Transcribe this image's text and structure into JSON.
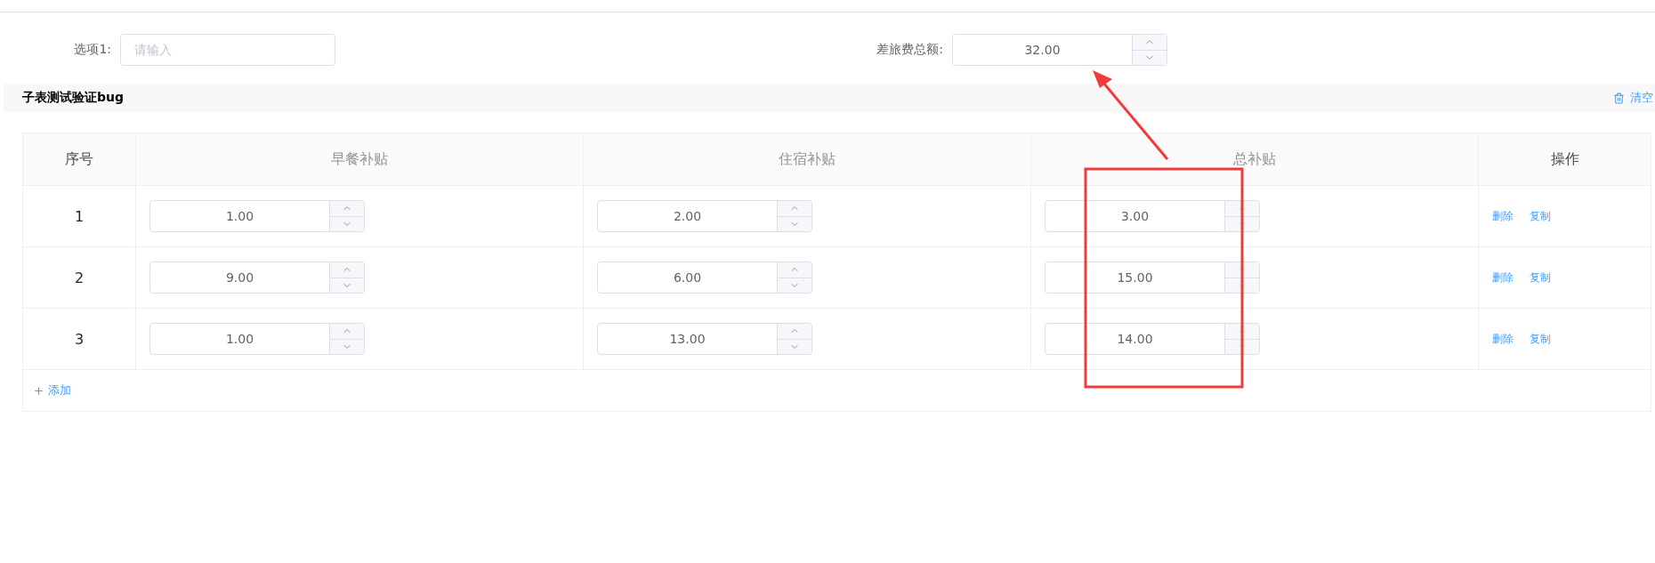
{
  "form": {
    "fields": [
      {
        "kind": "text",
        "label": "选项1:",
        "placeholder": "请输入"
      },
      {
        "kind": "number",
        "label": "差旅费总额:",
        "value": "32.00"
      }
    ]
  },
  "section": {
    "title": "子表测试验证bug",
    "clear_button": "清空"
  },
  "table": {
    "columns": [
      {
        "label": "序号",
        "muted": false
      },
      {
        "label": "早餐补贴",
        "muted": true
      },
      {
        "label": "住宿补贴",
        "muted": true
      },
      {
        "label": "总补贴",
        "muted": true
      },
      {
        "label": "操作",
        "muted": false
      }
    ],
    "rows": [
      {
        "index": "1",
        "cells": [
          "1.00",
          "2.00",
          "3.00"
        ],
        "actions": [
          "删除",
          "复制"
        ]
      },
      {
        "index": "2",
        "cells": [
          "9.00",
          "6.00",
          "15.00"
        ],
        "actions": [
          "删除",
          "复制"
        ]
      },
      {
        "index": "3",
        "cells": [
          "1.00",
          "13.00",
          "14.00"
        ],
        "actions": [
          "删除",
          "复制"
        ]
      }
    ],
    "add_button": "添加"
  }
}
